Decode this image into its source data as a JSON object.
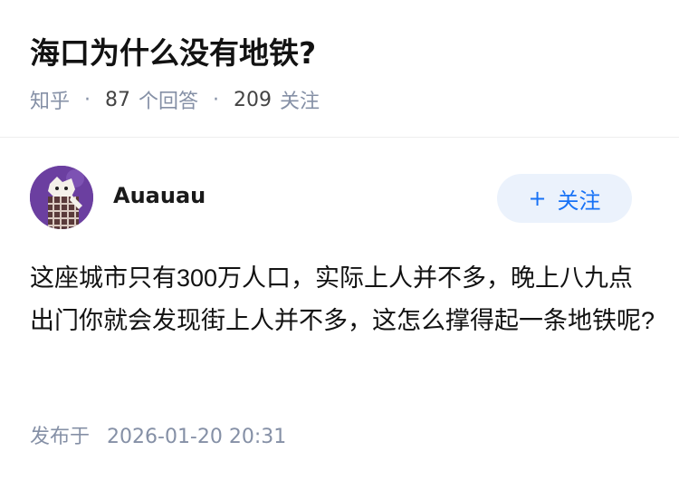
{
  "question": {
    "title": "海口为什么没有地铁?",
    "source": "知乎",
    "answers_count": "87",
    "answers_label": "个回答",
    "followers_count": "209",
    "followers_label": "关注"
  },
  "answer": {
    "author_name": "Auauau",
    "follow_label": "关注",
    "follow_icon": "plus-icon",
    "content": "这座城市只有300万人口，实际上人并不多，晚上八九点出门你就会发现街上人并不多，这怎么撑得起一条地铁呢?",
    "published_label": "发布于",
    "published_time": "2026-01-20 20:31"
  },
  "colors": {
    "accent": "#1772f6",
    "follow_bg": "#ebf2fc",
    "muted_text": "#8590a6",
    "avatar_bg": "#6b3fa0"
  }
}
